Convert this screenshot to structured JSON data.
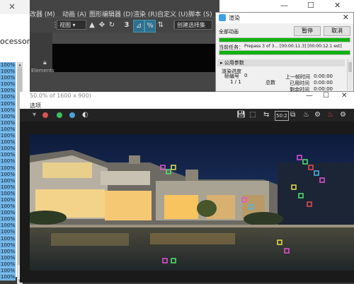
{
  "processor_panel": {
    "title": "ocessor",
    "rows": [
      "100%",
      "100%",
      "100%",
      "100%",
      "100%",
      "100%",
      "100%",
      "100%",
      "100%",
      "100%",
      "100%",
      "100%",
      "100%",
      "100%",
      "100%",
      "100%",
      "100%",
      "100%",
      "100%",
      "100%",
      "100%",
      "100%",
      "100%",
      "100%",
      "100%",
      "100%",
      "100%",
      "100%",
      "100%",
      "100%",
      "100%",
      "100%",
      "100%",
      "100%"
    ]
  },
  "menubar": {
    "items": [
      "改器 (M)",
      "动画 (A)",
      "图形编辑器 (D)",
      "渲染 (R)",
      "自定义 (U)",
      "脚本 (S)"
    ]
  },
  "toolbar": {
    "view_dropdown": "视图",
    "selection_set": "创建选择集"
  },
  "viewport": {
    "elements_label": "Elements"
  },
  "render_dialog": {
    "title": "渲染",
    "all_anim_label": "全部动画",
    "pause_button": "暂停",
    "cancel_button": "取消",
    "current_task_label": "当前任务：",
    "current_task_value": "Prepass 3 of 3...  [00:00:11.3] [00:00:12.1 est]",
    "progress": 1.0,
    "section_header": "公用参数",
    "progress_group": "渲染进度",
    "frame_label": "帧编号",
    "frame_value": "0",
    "frames_done": "1 / 1",
    "total_label": "总数",
    "last_frame_label": "上一帧时间",
    "last_frame_value": "0:00:00",
    "elapsed_label": "已用时间",
    "elapsed_value": "0:00:00",
    "remaining_label": "剩余时间",
    "remaining_value": "0:00:00"
  },
  "framebuffer": {
    "title": "50.0% of 1600 x 900)",
    "menu": "选项"
  },
  "colors": {
    "progress_fill": "#0fb20f",
    "processor_row": "#6cb0e3",
    "dot_red": "#d9534f",
    "dot_green": "#3cbf5b",
    "dot_blue": "#4aa3df"
  }
}
